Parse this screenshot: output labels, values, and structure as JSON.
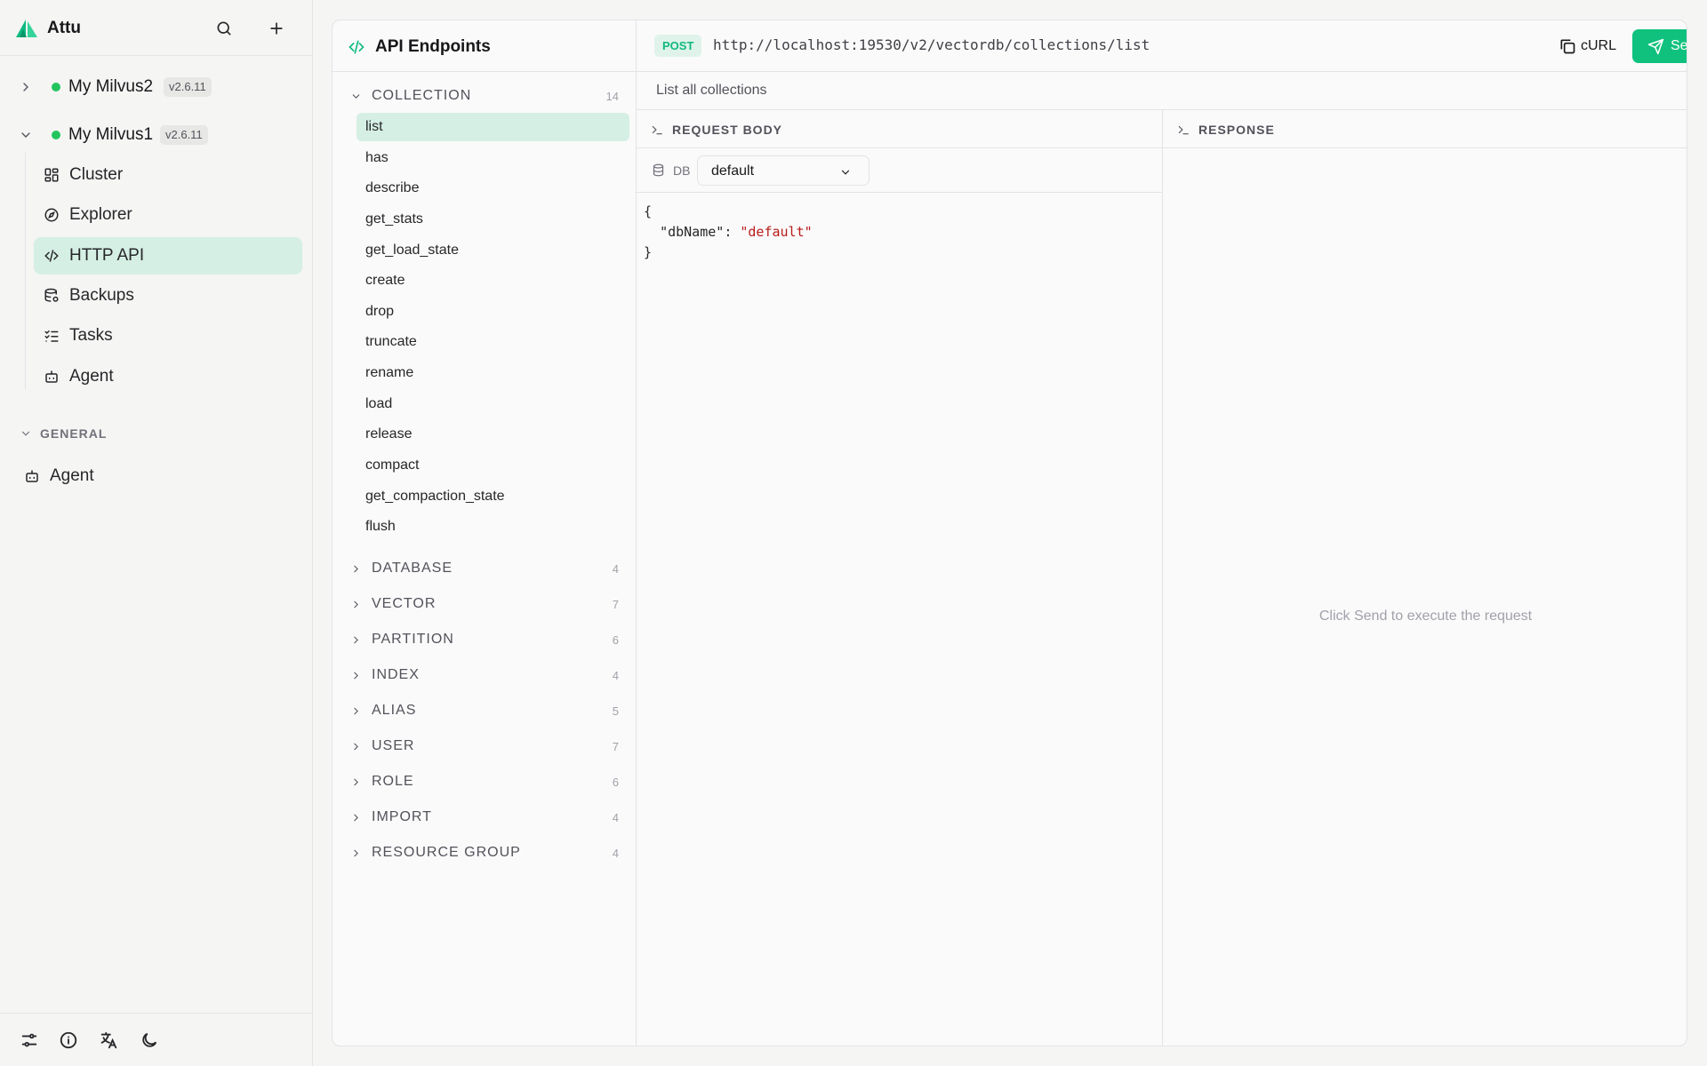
{
  "app": {
    "name": "Attu"
  },
  "connections": [
    {
      "name": "My Milvus2",
      "version": "v2.6.11",
      "expanded": false
    },
    {
      "name": "My Milvus1",
      "version": "v2.6.11",
      "expanded": true
    }
  ],
  "nav": [
    {
      "label": "Cluster",
      "icon": "cluster-icon"
    },
    {
      "label": "Explorer",
      "icon": "compass-icon"
    },
    {
      "label": "HTTP API",
      "icon": "code-icon",
      "active": true
    },
    {
      "label": "Backups",
      "icon": "database-backup-icon"
    },
    {
      "label": "Tasks",
      "icon": "list-checks-icon"
    },
    {
      "label": "Agent",
      "icon": "bot-icon"
    }
  ],
  "general": {
    "label": "GENERAL",
    "agent": "Agent"
  },
  "endpoints": {
    "title": "API Endpoints",
    "open_group": {
      "name": "COLLECTION",
      "count": "14"
    },
    "items": [
      "list",
      "has",
      "describe",
      "get_stats",
      "get_load_state",
      "create",
      "drop",
      "truncate",
      "rename",
      "load",
      "release",
      "compact",
      "get_compaction_state",
      "flush"
    ],
    "groups": [
      {
        "name": "DATABASE",
        "count": "4"
      },
      {
        "name": "VECTOR",
        "count": "7"
      },
      {
        "name": "PARTITION",
        "count": "6"
      },
      {
        "name": "INDEX",
        "count": "4"
      },
      {
        "name": "ALIAS",
        "count": "5"
      },
      {
        "name": "USER",
        "count": "7"
      },
      {
        "name": "ROLE",
        "count": "6"
      },
      {
        "name": "IMPORT",
        "count": "4"
      },
      {
        "name": "RESOURCE GROUP",
        "count": "4"
      }
    ]
  },
  "request": {
    "method": "POST",
    "url": "http://localhost:19530/v2/vectordb/collections/list",
    "curl_label": "cURL",
    "send_label": "Send",
    "description": "List all collections",
    "body_label": "REQUEST BODY",
    "db_label": "DB",
    "db_value": "default",
    "body_open": "{",
    "body_key": "\"dbName\"",
    "body_sep": ": ",
    "body_value": "\"default\"",
    "body_close": "}"
  },
  "response": {
    "label": "RESPONSE",
    "placeholder": "Click Send to execute the request"
  },
  "colors": {
    "accent": "#10c17d",
    "active_bg": "#d5efe4",
    "status_dot": "#22c55e"
  }
}
